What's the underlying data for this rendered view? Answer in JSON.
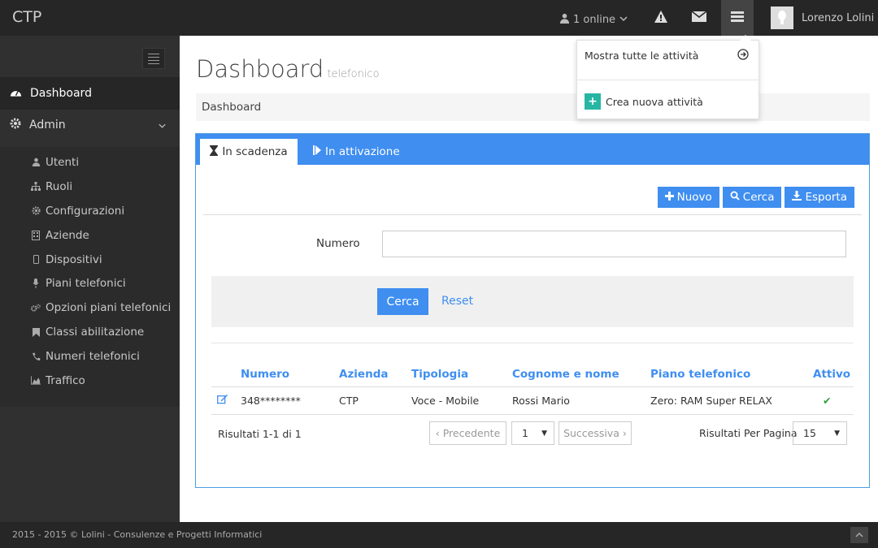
{
  "app": {
    "brand": "CTP"
  },
  "topbar": {
    "online_label": "1 online",
    "user_name": "Lorenzo Lolini",
    "icons": [
      "user-icon",
      "chevron-down-icon",
      "warning-icon",
      "envelope-icon",
      "tasks-icon"
    ]
  },
  "sidebar": {
    "dashboard_label": "Dashboard",
    "admin_label": "Admin",
    "items": [
      {
        "label": "Utenti",
        "icon": "user-icon"
      },
      {
        "label": "Ruoli",
        "icon": "sitemap-icon"
      },
      {
        "label": "Configurazioni",
        "icon": "gear-icon"
      },
      {
        "label": "Aziende",
        "icon": "building-icon"
      },
      {
        "label": "Dispositivi",
        "icon": "mobile-icon"
      },
      {
        "label": "Piani telefonici",
        "icon": "microphone-icon"
      },
      {
        "label": "Opzioni piani telefonici",
        "icon": "gears-icon"
      },
      {
        "label": "Classi abilitazione",
        "icon": "bookmark-icon"
      },
      {
        "label": "Numeri telefonici",
        "icon": "phone-icon"
      },
      {
        "label": "Traffico",
        "icon": "area-chart-icon"
      }
    ]
  },
  "page": {
    "title": "Dashboard",
    "subtitle": "telefonico",
    "breadcrumb": "Dashboard"
  },
  "tabs": {
    "active": "In scadenza",
    "inactive": "In attivazione"
  },
  "toolbar": {
    "new_label": "Nuovo",
    "search_label": "Cerca",
    "export_label": "Esporta"
  },
  "filter": {
    "numero_label": "Numero",
    "numero_value": "",
    "search_button": "Cerca",
    "reset_link": "Reset"
  },
  "table": {
    "headers": [
      "Numero",
      "Azienda",
      "Tipologia",
      "Cognome e nome",
      "Piano telefonico",
      "Attivo"
    ],
    "rows": [
      {
        "numero": "348********",
        "azienda": "CTP",
        "tipologia": "Voce - Mobile",
        "nome": "Rossi Mario",
        "piano": "Zero: RAM Super RELAX",
        "attivo": "✔"
      }
    ]
  },
  "pagination": {
    "results_text": "Risultati 1-1 di 1",
    "prev_label": "‹ Precedente",
    "page_value": "1",
    "next_label": "Successiva ›",
    "per_page_label": "Risultati Per Pagina",
    "per_page_value": "15"
  },
  "dropdown": {
    "show_all_label": "Mostra tutte le attività",
    "create_label": "Crea nuova attività"
  },
  "footer": {
    "text": "2015 - 2015 © Lolini - Consulenze e Progetti Informatici"
  },
  "colors": {
    "accent": "#3f8ef0",
    "topbar": "#262626",
    "sidebar": "#303030",
    "success": "#2e9e3e",
    "teal": "#26b6a3"
  }
}
